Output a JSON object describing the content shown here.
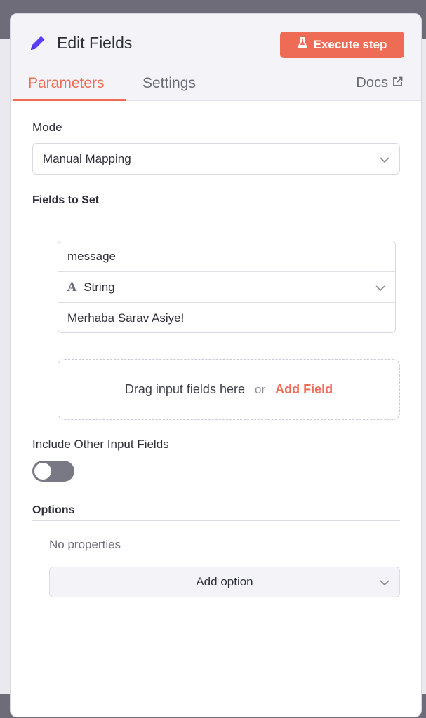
{
  "header": {
    "title": "Edit Fields",
    "title_icon": "pencil-icon",
    "execute_label": "Execute step",
    "execute_icon": "flask-icon",
    "accent_color": "#ee6c55"
  },
  "tabs": {
    "items": [
      {
        "label": "Parameters",
        "active": true
      },
      {
        "label": "Settings",
        "active": false
      }
    ],
    "docs_label": "Docs",
    "docs_icon": "external-link-icon"
  },
  "mode": {
    "label": "Mode",
    "value": "Manual Mapping"
  },
  "fields_to_set": {
    "label": "Fields to Set",
    "field": {
      "name": "message",
      "type": "String",
      "type_icon": "A",
      "value": "Merhaba Sarav Asiye!"
    },
    "dropzone_text": "Drag input fields here",
    "dropzone_or": "or",
    "add_field_label": "Add Field"
  },
  "include_other": {
    "label": "Include Other Input Fields",
    "enabled": false
  },
  "options": {
    "label": "Options",
    "empty_text": "No properties",
    "add_option_label": "Add option"
  }
}
